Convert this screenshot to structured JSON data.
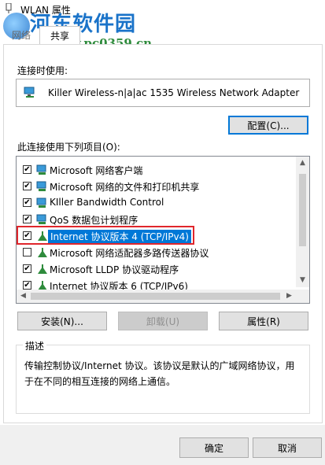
{
  "window": {
    "title": "WLAN 属性",
    "watermark_title": "河东软件园",
    "watermark_url": "www.pc0359.cn"
  },
  "tabs": [
    {
      "label": "网络"
    },
    {
      "label": "共享"
    }
  ],
  "connect_using_label": "连接时使用:",
  "adapter_name": "Killer Wireless-n|a|ac 1535 Wireless Network Adapter",
  "configure_button": "配置(C)...",
  "items_label": "此连接使用下列项目(O):",
  "items": [
    {
      "label": "Microsoft 网络客户端",
      "checked": true,
      "icon": "client-icon"
    },
    {
      "label": "Microsoft 网络的文件和打印机共享",
      "checked": true,
      "icon": "service-icon"
    },
    {
      "label": "KIller Bandwidth Control",
      "checked": true,
      "icon": "service-icon"
    },
    {
      "label": "QoS 数据包计划程序",
      "checked": true,
      "icon": "service-icon"
    },
    {
      "label": "Internet 协议版本 4 (TCP/IPv4)",
      "checked": true,
      "icon": "protocol-icon",
      "selected": true
    },
    {
      "label": "Microsoft 网络适配器多路传送器协议",
      "checked": false,
      "icon": "protocol-icon"
    },
    {
      "label": "Microsoft LLDP 协议驱动程序",
      "checked": true,
      "icon": "protocol-icon"
    },
    {
      "label": "Internet 协议版本 6 (TCP/IPv6)",
      "checked": true,
      "icon": "protocol-icon"
    }
  ],
  "buttons": {
    "install": "安装(N)...",
    "uninstall": "卸载(U)",
    "properties": "属性(R)",
    "ok": "确定",
    "cancel": "取消"
  },
  "description": {
    "legend": "描述",
    "text": "传输控制协议/Internet 协议。该协议是默认的广域网络协议，用于在不同的相互连接的网络上通信。"
  },
  "colors": {
    "accent": "#0078d7",
    "highlight_border": "#e0262c"
  }
}
